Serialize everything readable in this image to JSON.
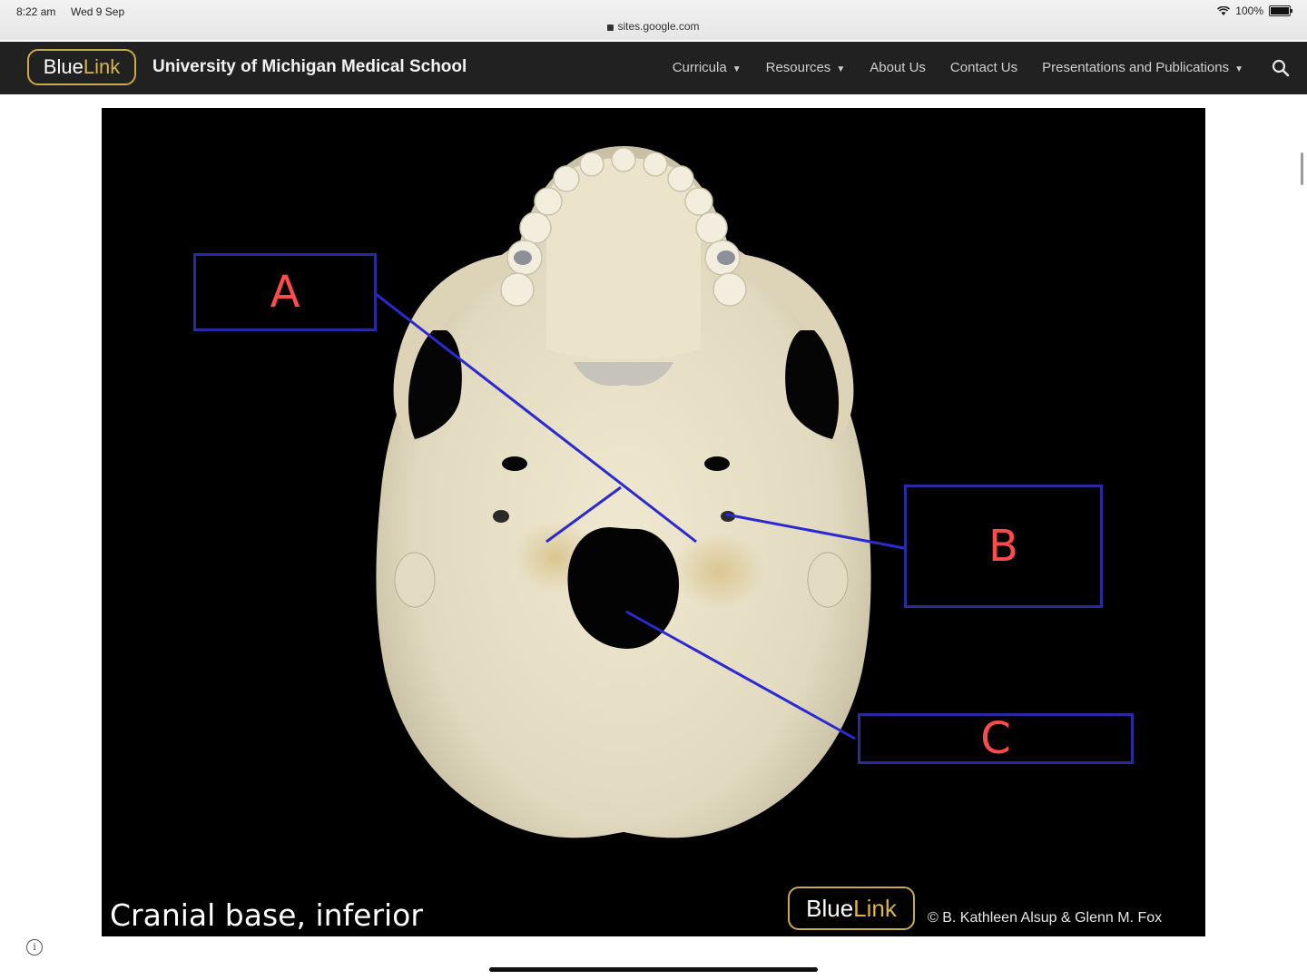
{
  "status_bar": {
    "time": "8:22 am",
    "date": "Wed 9 Sep",
    "url": "sites.google.com",
    "battery": "100%"
  },
  "site": {
    "logo_part1": "Blue",
    "logo_part2": "Link",
    "title": "University of Michigan Medical School",
    "nav": [
      "Curricula",
      "Resources",
      "About Us",
      "Contact Us",
      "Presentations and Publications"
    ]
  },
  "figure": {
    "caption": "Cranial base, inferior",
    "logo_part1": "Blue",
    "logo_part2": "Link",
    "credit": "© B. Kathleen Alsup & Glenn M. Fox",
    "labels": {
      "a": "A",
      "b": "B",
      "c": "C"
    }
  },
  "colors": {
    "nav_bg": "#212121",
    "brand_gold": "#d9b44a",
    "label_box": "#2a2aa0",
    "label_text": "#ff4b4b",
    "leader_line": "#2a2ad0"
  }
}
